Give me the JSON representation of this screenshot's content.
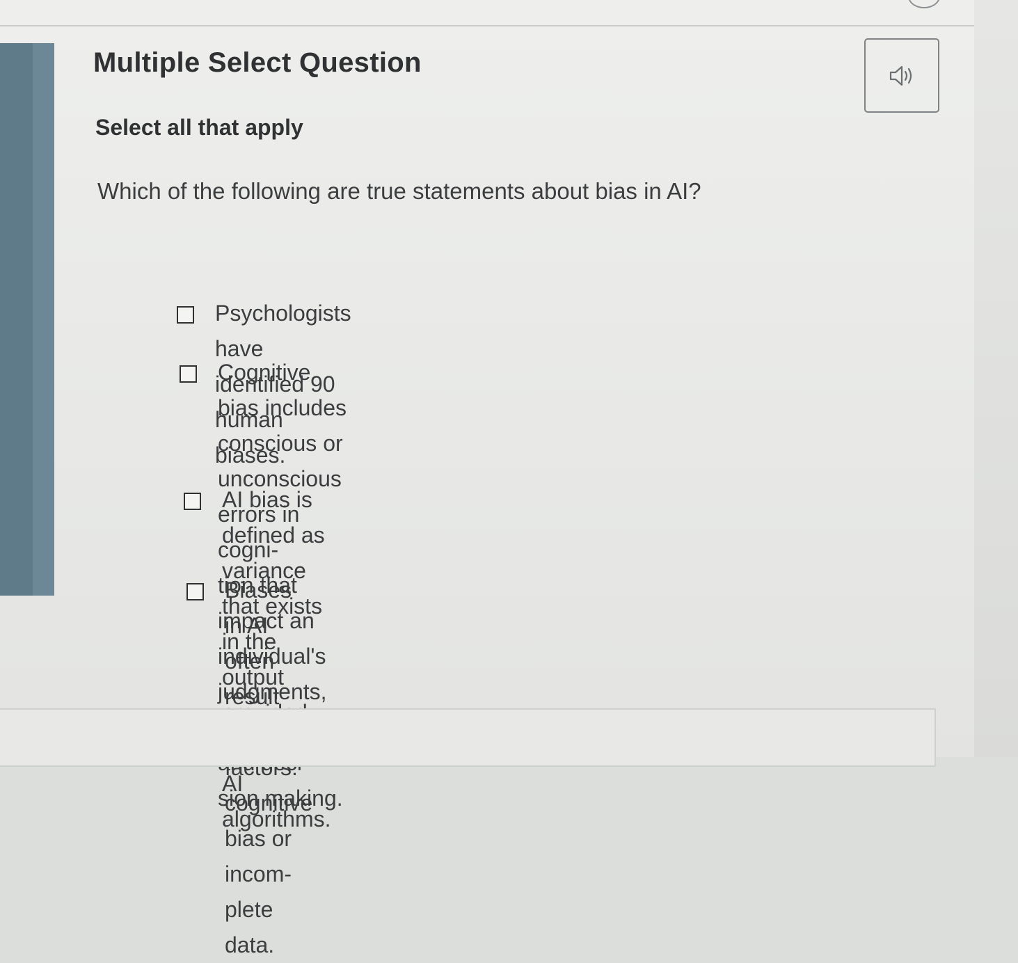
{
  "question": {
    "type_title": "Multiple Select Question",
    "instruction": "Select all that apply",
    "prompt": "Which of the following are true statements about bias in AI?",
    "audio_icon": "speaker-icon"
  },
  "options": [
    {
      "lines": [
        "Psychologists have identified 90 human biases."
      ],
      "checked": false
    },
    {
      "lines": [
        "Cognitive bias includes conscious or unconscious errors in cogni-",
        "tion that impact an individual's judgments, assumptions, and deci-",
        "sion making."
      ],
      "checked": false
    },
    {
      "lines": [
        "AI bias is defined as variance that exists in the output provided by",
        "AI algorithms."
      ],
      "checked": false
    },
    {
      "lines": [
        "Biases in AI often result from two factors: cognitive bias or incom-",
        "plete data."
      ],
      "checked": false
    }
  ],
  "colors": {
    "sidebar_accent": "#5f7b8a",
    "text": "#3c3d3f"
  }
}
